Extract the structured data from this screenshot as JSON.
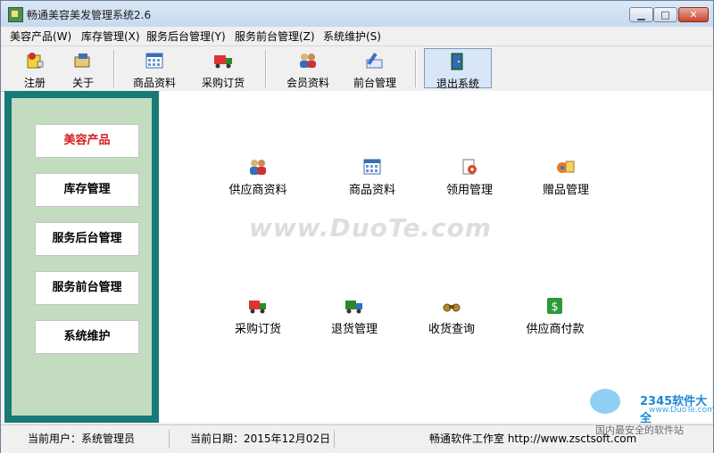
{
  "window": {
    "title": "畅通美容美发管理系统2.6",
    "controls": {
      "minimize": "▁",
      "maximize": "□",
      "close": "✕"
    }
  },
  "menubar": {
    "items": [
      "美容产品(W)",
      "库存管理(X)",
      "服务后台管理(Y)",
      "服务前台管理(Z)",
      "系统维护(S)"
    ]
  },
  "toolbar": {
    "buttons": [
      {
        "label": "注册",
        "icon": "register-icon"
      },
      {
        "label": "关于",
        "icon": "about-icon"
      },
      {
        "label": "商品资料",
        "icon": "product-grid-icon"
      },
      {
        "label": "采购订货",
        "icon": "truck-icon"
      },
      {
        "label": "会员资料",
        "icon": "members-icon"
      },
      {
        "label": "前台管理",
        "icon": "pen-icon"
      },
      {
        "label": "退出系统",
        "icon": "exit-door-icon"
      }
    ],
    "active": "退出系统"
  },
  "sidebar": {
    "items": [
      "美容产品",
      "库存管理",
      "服务后台管理",
      "服务前台管理",
      "系统维护"
    ],
    "active_index": 0
  },
  "main": {
    "items": [
      {
        "label": "供应商资料",
        "icon": "suppliers-icon"
      },
      {
        "label": "商品资料",
        "icon": "product-grid-icon"
      },
      {
        "label": "领用管理",
        "icon": "requisition-icon"
      },
      {
        "label": "赠品管理",
        "icon": "gift-icon"
      },
      {
        "label": "采购订货",
        "icon": "truck-icon"
      },
      {
        "label": "退货管理",
        "icon": "return-truck-icon"
      },
      {
        "label": "收货查询",
        "icon": "binoculars-icon"
      },
      {
        "label": "供应商付款",
        "icon": "payment-icon"
      }
    ],
    "watermark": "www.DuoTe.com"
  },
  "statusbar": {
    "user": "当前用户：系统管理员",
    "date": "当前日期：2015年12月02日",
    "company": "畅通软件工作室 http://www.zsctsoft.com"
  },
  "badge": {
    "brand": "2345软件大全",
    "site": "www.DuoTe.com",
    "slogan": "国内最安全的软件站"
  },
  "colors": {
    "sidebar_frame": "#177a76",
    "sidebar_fill": "#c3dcc0",
    "active_text": "#d41f1f"
  }
}
